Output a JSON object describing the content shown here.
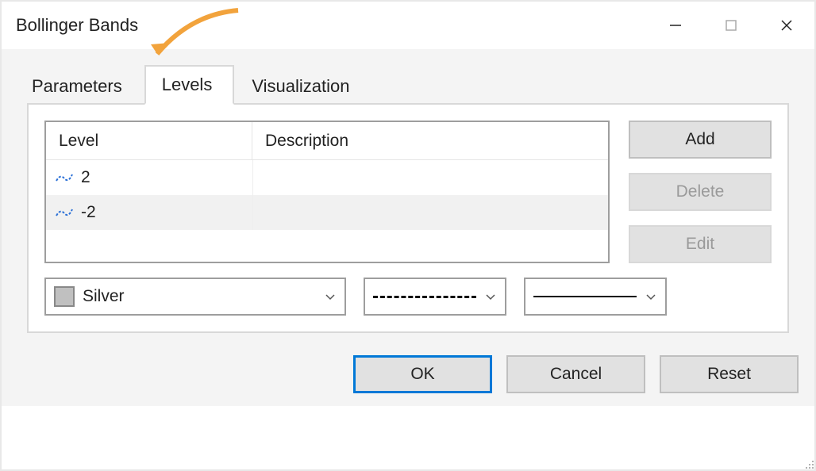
{
  "window": {
    "title": "Bollinger Bands"
  },
  "tabs": [
    {
      "label": "Parameters",
      "active": false
    },
    {
      "label": "Levels",
      "active": true
    },
    {
      "label": "Visualization",
      "active": false
    }
  ],
  "table": {
    "headers": {
      "level": "Level",
      "description": "Description"
    },
    "rows": [
      {
        "value": "2",
        "description": ""
      },
      {
        "value": "-2",
        "description": ""
      }
    ]
  },
  "side_buttons": {
    "add": {
      "label": "Add",
      "enabled": true
    },
    "delete": {
      "label": "Delete",
      "enabled": false
    },
    "edit": {
      "label": "Edit",
      "enabled": false
    }
  },
  "selectors": {
    "color": {
      "name": "Silver",
      "swatch": "#c0c0c0"
    },
    "style": "dashed",
    "width": "thin"
  },
  "dialog_buttons": {
    "ok": "OK",
    "cancel": "Cancel",
    "reset": "Reset"
  }
}
